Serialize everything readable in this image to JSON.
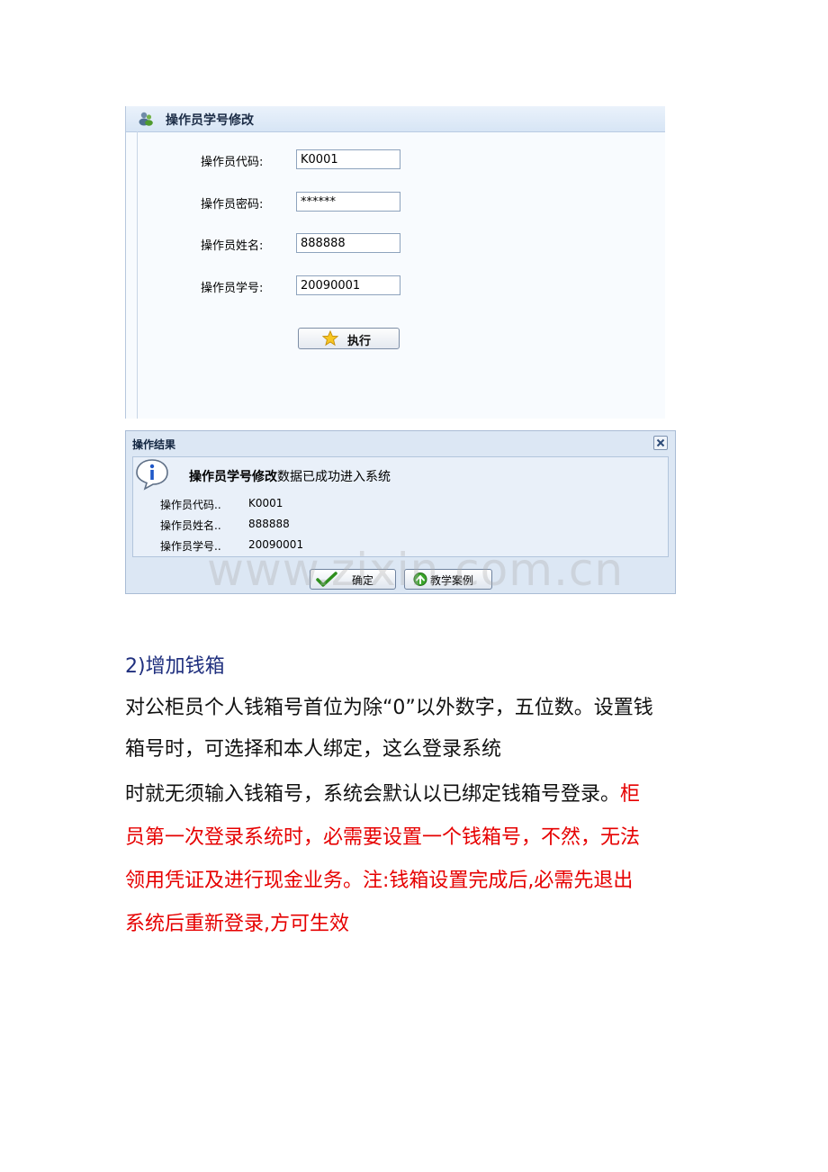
{
  "form": {
    "title": "操作员学号修改",
    "fields": [
      {
        "label": "操作员代码:",
        "value": "K0001"
      },
      {
        "label": "操作员密码:",
        "value": "******"
      },
      {
        "label": "操作员姓名:",
        "value": "888888"
      },
      {
        "label": "操作员学号:",
        "value": "20090001"
      }
    ],
    "execute_label": "执行"
  },
  "result": {
    "title": "操作结果",
    "message_bold": "操作员学号修改",
    "message_rest": "数据已成功进入系统",
    "lines": [
      {
        "label": "操作员代码..",
        "value": "K0001"
      },
      {
        "label": "操作员姓名..",
        "value": "888888"
      },
      {
        "label": "操作员学号..",
        "value": "20090001"
      }
    ],
    "ok_label": "确定",
    "case_label": "教学案例"
  },
  "watermark": "www.zixin.com.cn",
  "doc": {
    "heading": "2)增加钱箱",
    "line1": "对公柜员个人钱箱号首位为除“0”以外数字，五位数。设置钱",
    "line2": "箱号时，可选择和本人绑定，这么登录系统",
    "line3_black": "时就无须输入钱箱号，系统会默认以已绑定钱箱号登录。",
    "line3_red": "柜",
    "line4": "员第一次登录系统时，必需要设置一个钱箱号，不然，无法",
    "line5": "领用凭证及进行现金业务。注:钱箱设置完成后,必需先退出",
    "line6": "系统后重新登录,方可生效"
  },
  "colors": {
    "heading": "#1f2f7e",
    "red_text": "#e60000",
    "panel_header": "#d7e5f5"
  },
  "icons": [
    "users-icon",
    "star-icon",
    "info-icon",
    "close-icon",
    "checkmark-icon",
    "refresh-icon"
  ]
}
